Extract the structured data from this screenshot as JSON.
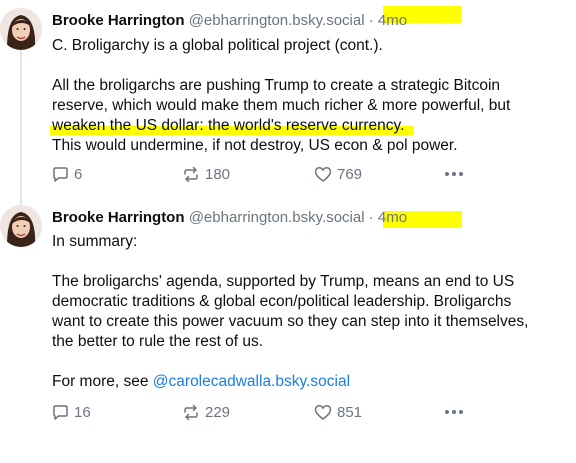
{
  "posts": [
    {
      "display_name": "Brooke Harrington",
      "handle": "@ebharrington.bsky.social",
      "separator": "·",
      "time": "4mo",
      "lines": [
        "C. Broligarchy is a global political project (cont.).",
        "",
        "All the broligarchs are pushing Trump to create a strategic Bitcoin",
        "reserve, which would make them much richer & more powerful, but",
        "weaken the US dollar: the world's reserve currency.",
        "This would undermine, if not destroy, US econ & pol power."
      ],
      "replies": "6",
      "reposts": "180",
      "likes": "769"
    },
    {
      "display_name": "Brooke Harrington",
      "handle": "@ebharrington.bsky.social",
      "separator": "·",
      "time": "4mo",
      "lines": [
        "In summary:",
        "",
        "The broligarchs' agenda, supported by Trump, means an end to US",
        "democratic traditions & global econ/political leadership. Broligarchs",
        "want to create this power vacuum so they can step into it themselves,",
        "the better to rule the rest of us.",
        "",
        "For more, see"
      ],
      "mention": "@carolecadwalla.bsky.social",
      "replies": "16",
      "reposts": "229",
      "likes": "851"
    }
  ],
  "icons": {
    "reply": "speech-bubble-icon",
    "repost": "repost-arrows-icon",
    "like": "heart-icon",
    "more": "more-dots-icon"
  },
  "colors": {
    "highlight": "#ffff00",
    "muted": "#6b7480",
    "mention": "#1a7de8",
    "thread_line": "#e3e6ea"
  }
}
